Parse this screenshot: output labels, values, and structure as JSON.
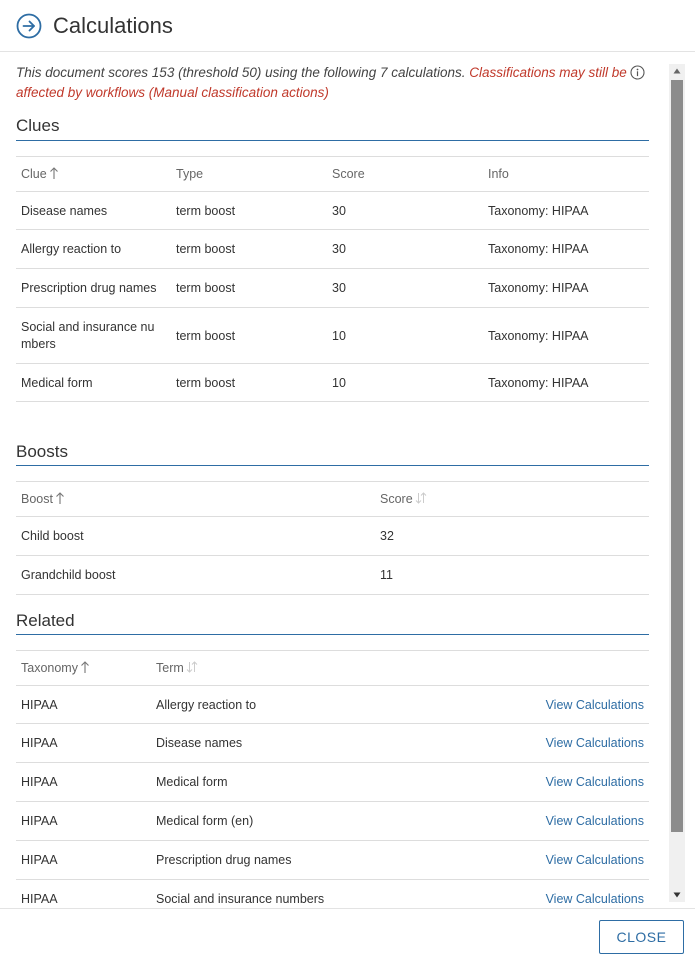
{
  "header": {
    "title": "Calculations",
    "icon": "arrow-circle-right-icon"
  },
  "summary": {
    "text": "This document scores 153 (threshold 50) using the following 7 calculations.",
    "warning_line1": "Classifications may still be",
    "warning_line2": "affected by workflows (Manual classification actions)"
  },
  "clues": {
    "title": "Clues",
    "columns": [
      "Clue",
      "Type",
      "Score",
      "Info"
    ],
    "rows": [
      [
        "Disease names",
        "term boost",
        "30",
        "Taxonomy: HIPAA"
      ],
      [
        "Allergy reaction to",
        "term boost",
        "30",
        "Taxonomy: HIPAA"
      ],
      [
        "Prescription drug names",
        "term boost",
        "30",
        "Taxonomy: HIPAA"
      ],
      [
        "Social and insurance nu mbers",
        "term boost",
        "10",
        "Taxonomy: HIPAA"
      ],
      [
        "Medical form",
        "term boost",
        "10",
        "Taxonomy: HIPAA"
      ]
    ]
  },
  "boosts": {
    "title": "Boosts",
    "columns": [
      "Boost",
      "Score"
    ],
    "rows": [
      [
        "Child boost",
        "32"
      ],
      [
        "Grandchild boost",
        "11"
      ]
    ]
  },
  "related": {
    "title": "Related",
    "columns": [
      "Taxonomy",
      "Term"
    ],
    "link_label": "View Calculations",
    "rows": [
      [
        "HIPAA",
        "Allergy reaction to"
      ],
      [
        "HIPAA",
        "Disease names"
      ],
      [
        "HIPAA",
        "Medical form"
      ],
      [
        "HIPAA",
        "Medical form (en)"
      ],
      [
        "HIPAA",
        "Prescription drug names"
      ],
      [
        "HIPAA",
        "Social and insurance numbers"
      ]
    ]
  },
  "footer": {
    "close_label": "CLOSE"
  },
  "colors": {
    "accent": "#2e6da4",
    "warning": "#c0392b",
    "scrollbar": "#8c8c8c"
  }
}
